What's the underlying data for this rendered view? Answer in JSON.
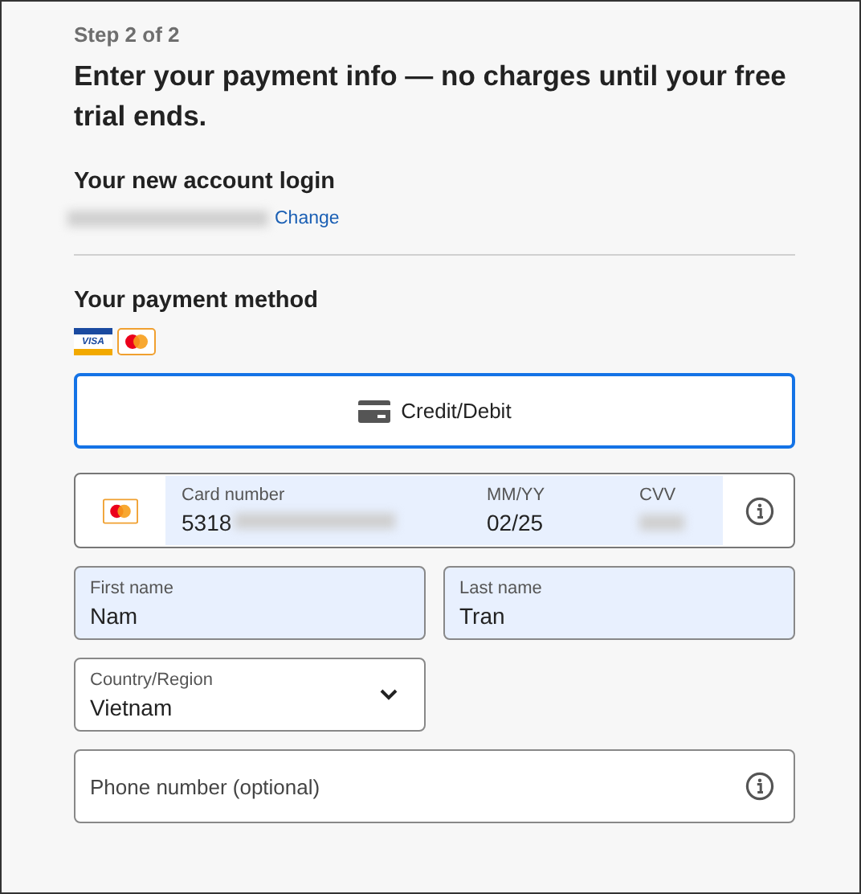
{
  "step": "Step 2 of 2",
  "heading": "Enter your payment info — no charges until your free trial ends.",
  "account": {
    "title": "Your new account login",
    "email_redacted": true,
    "change_link": "Change"
  },
  "payment": {
    "title": "Your payment method",
    "logos": [
      {
        "kind": "visa",
        "label": "VISA"
      },
      {
        "kind": "mastercard"
      }
    ],
    "methods": [
      {
        "label": "Credit/Debit",
        "selected": true
      }
    ]
  },
  "card": {
    "autofilled": true,
    "number": {
      "label": "Card number",
      "value": "5318",
      "redacted": true
    },
    "expiry": {
      "label": "MM/YY",
      "value": "02/25"
    },
    "cvv": {
      "label": "CVV",
      "redacted": true
    }
  },
  "fields": [
    {
      "kind": "text",
      "label": "First name",
      "value": "Nam",
      "autofilled": true
    },
    {
      "kind": "text",
      "label": "Last name",
      "value": "Tran",
      "autofilled": true
    },
    {
      "kind": "select",
      "label": "Country/Region",
      "value": "Vietnam",
      "autofilled": false
    },
    {
      "kind": "info",
      "placeholder": "Phone number (optional)",
      "autofilled": false
    }
  ]
}
